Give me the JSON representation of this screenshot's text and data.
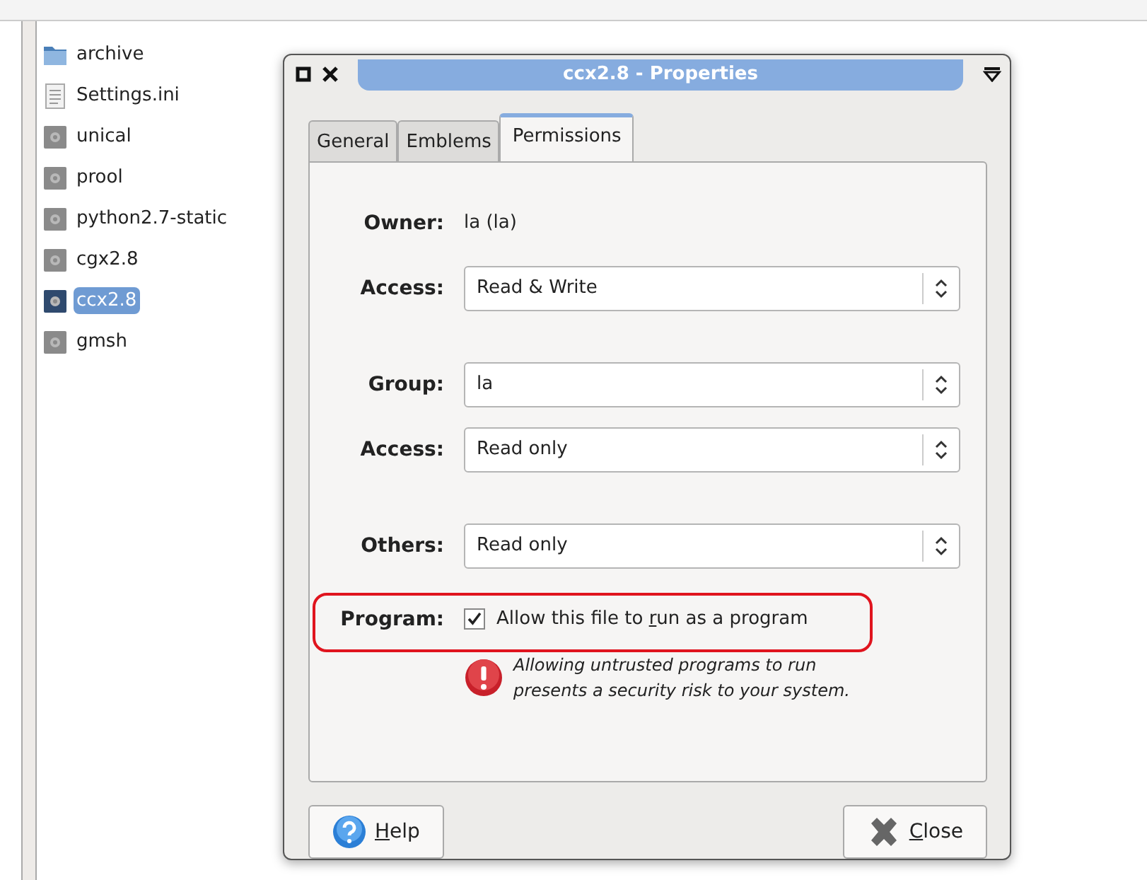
{
  "files": [
    {
      "name": "archive",
      "kind": "folder",
      "selected": false
    },
    {
      "name": "Settings.ini",
      "kind": "text",
      "selected": false
    },
    {
      "name": "unical",
      "kind": "program",
      "selected": false
    },
    {
      "name": "prool",
      "kind": "program",
      "selected": false
    },
    {
      "name": "python2.7-static",
      "kind": "program",
      "selected": false
    },
    {
      "name": "cgx2.8",
      "kind": "program",
      "selected": false
    },
    {
      "name": "ccx2.8",
      "kind": "program",
      "selected": true
    },
    {
      "name": "gmsh",
      "kind": "program",
      "selected": false
    }
  ],
  "dialog": {
    "title": "ccx2.8 - Properties",
    "tabs": [
      {
        "label": "General",
        "selected": false
      },
      {
        "label": "Emblems",
        "selected": false
      },
      {
        "label": "Permissions",
        "selected": true
      }
    ],
    "rows": [
      {
        "kind": "text",
        "label": "Owner:",
        "value": "la (la)"
      },
      {
        "kind": "combo",
        "label": "Access:",
        "value": "Read & Write"
      },
      {
        "kind": "gap"
      },
      {
        "kind": "combo",
        "label": "Group:",
        "value": "la"
      },
      {
        "kind": "combo",
        "label": "Access:",
        "value": "Read only"
      },
      {
        "kind": "gap"
      },
      {
        "kind": "combo",
        "label": "Others:",
        "value": "Read only"
      },
      {
        "kind": "check",
        "label": "Program:",
        "text_before": "Allow this file to ",
        "mnemonic": "r",
        "text_after": "un as a program",
        "checked": true,
        "highlight": true
      },
      {
        "kind": "warning",
        "text": "Allowing untrusted programs to run presents a security risk to your system."
      }
    ],
    "buttons": [
      {
        "kind": "help",
        "mnemonic": "H",
        "rest": "elp"
      },
      {
        "kind": "close",
        "mnemonic": "C",
        "rest": "lose"
      }
    ]
  }
}
